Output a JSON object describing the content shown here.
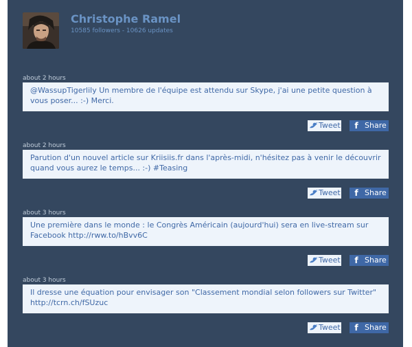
{
  "profile": {
    "name": "Christophe Ramel",
    "stats": "10585 followers - 10626 updates"
  },
  "colors": {
    "background": "#34475f",
    "name_link": "#6a93c4",
    "tweet_box": "#eef4fb",
    "tweet_text": "#3f68a6",
    "share_button": "#3f68a6"
  },
  "tweets": [
    {
      "time": "about 2 hours",
      "text": "@WassupTigerlily Un membre de l'équipe est attendu sur Skype, j'ai une petite question à vous poser... :-) Merci.",
      "tweet_label": "Tweet",
      "share_label": "Share"
    },
    {
      "time": "about 2 hours",
      "text": "Parution d'un nouvel article sur Kriisiis.fr dans l'après-midi, n'hésitez pas à venir le découvrir quand vous aurez le temps... :-) #Teasing",
      "tweet_label": "Tweet",
      "share_label": "Share"
    },
    {
      "time": "about 3 hours",
      "text": "Une première dans le monde : le Congrès Américain (aujourd'hui) sera en live-stream sur Facebook http://rww.to/hBvv6C",
      "tweet_label": "Tweet",
      "share_label": "Share"
    },
    {
      "time": "about 3 hours",
      "text": "Il dresse une équation pour envisager son \"Classement mondial selon followers sur Twitter\" http://tcrn.ch/fSUzuc",
      "tweet_label": "Tweet",
      "share_label": "Share"
    }
  ],
  "icons": {
    "avatar": "profile-photo",
    "tweet": "bird-icon",
    "share": "facebook-icon"
  }
}
